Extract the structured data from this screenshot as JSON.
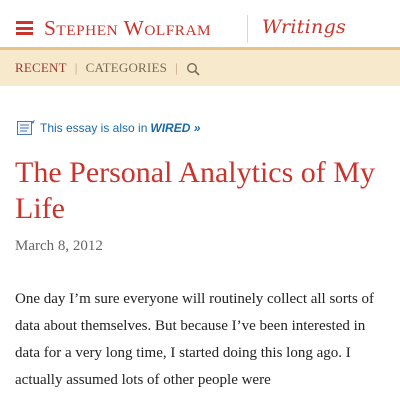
{
  "header": {
    "brand": "Stephen Wolfram",
    "section_logo": "Writings"
  },
  "nav": {
    "items": [
      {
        "label": "RECENT"
      },
      {
        "label": "CATEGORIES"
      }
    ],
    "search_icon": "search-icon"
  },
  "notice": {
    "text": "This essay is also in",
    "link": "WIRED »"
  },
  "article": {
    "title": "The Personal Analytics of My Life",
    "date": "March 8, 2012",
    "body": "One day I’m sure everyone will routinely collect all sorts of data about themselves. But because I’ve been interested in data for a very long time, I started doing this long ago. I actually assumed lots of other people were"
  },
  "colors": {
    "brand_red": "#c9342d",
    "nav_bg": "#f7e9cc",
    "link_blue": "#1a6aa8"
  }
}
